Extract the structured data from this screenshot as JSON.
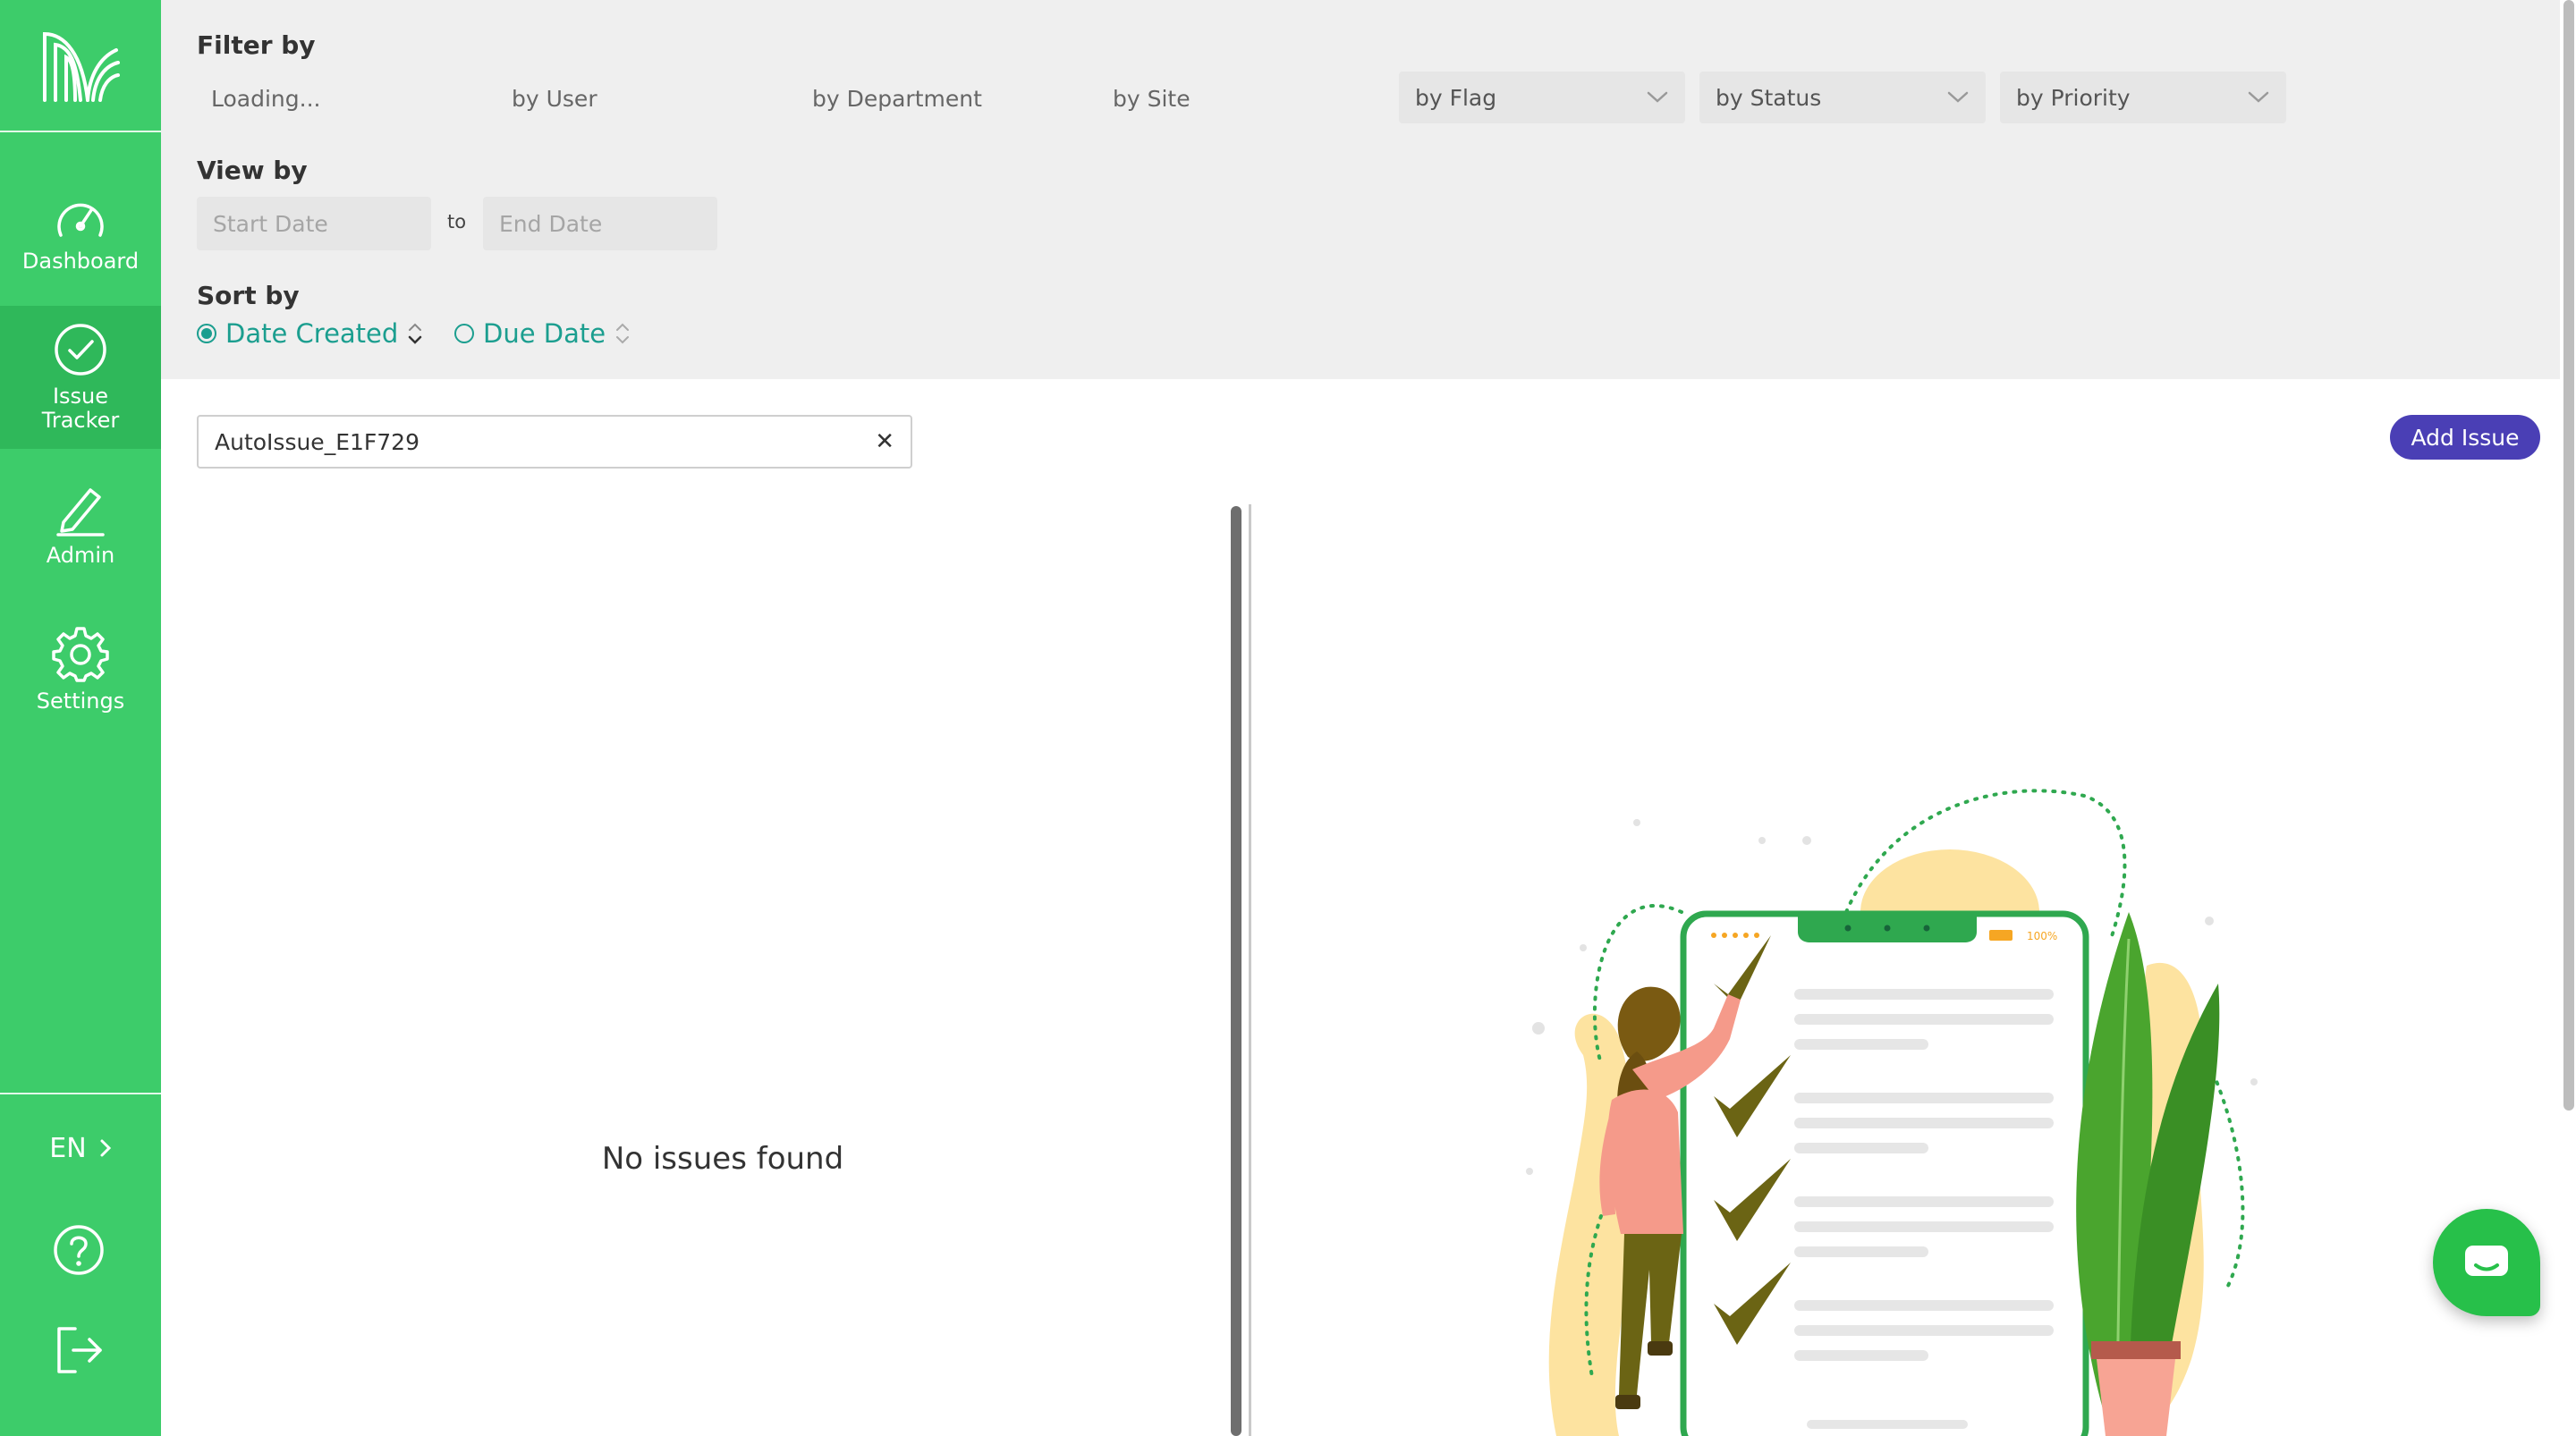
{
  "sidebar": {
    "nav": [
      {
        "label": "Dashboard",
        "icon": "speedometer-icon"
      },
      {
        "label": "Issue Tracker",
        "label_line1": "Issue",
        "label_line2": "Tracker",
        "icon": "check-circle-icon",
        "active": true
      },
      {
        "label": "Admin",
        "icon": "pencil-icon"
      },
      {
        "label": "Settings",
        "icon": "gear-icon"
      }
    ],
    "language": "EN",
    "accent_color": "#3dcc6a"
  },
  "filters": {
    "title": "Filter by",
    "loading": "Loading...",
    "by_user": "by User",
    "by_department": "by Department",
    "by_site": "by Site",
    "by_flag": "by Flag",
    "by_status": "by Status",
    "by_priority": "by Priority"
  },
  "view": {
    "title": "View by",
    "start_placeholder": "Start Date",
    "to_label": "to",
    "end_placeholder": "End Date"
  },
  "sort": {
    "title": "Sort by",
    "options": [
      {
        "label": "Date Created",
        "selected": true
      },
      {
        "label": "Due Date",
        "selected": false
      }
    ]
  },
  "search": {
    "value": "AutoIssue_E1F729"
  },
  "add_issue_label": "Add Issue",
  "empty_message": "No issues found",
  "illustration": {
    "battery_label": "100%"
  }
}
